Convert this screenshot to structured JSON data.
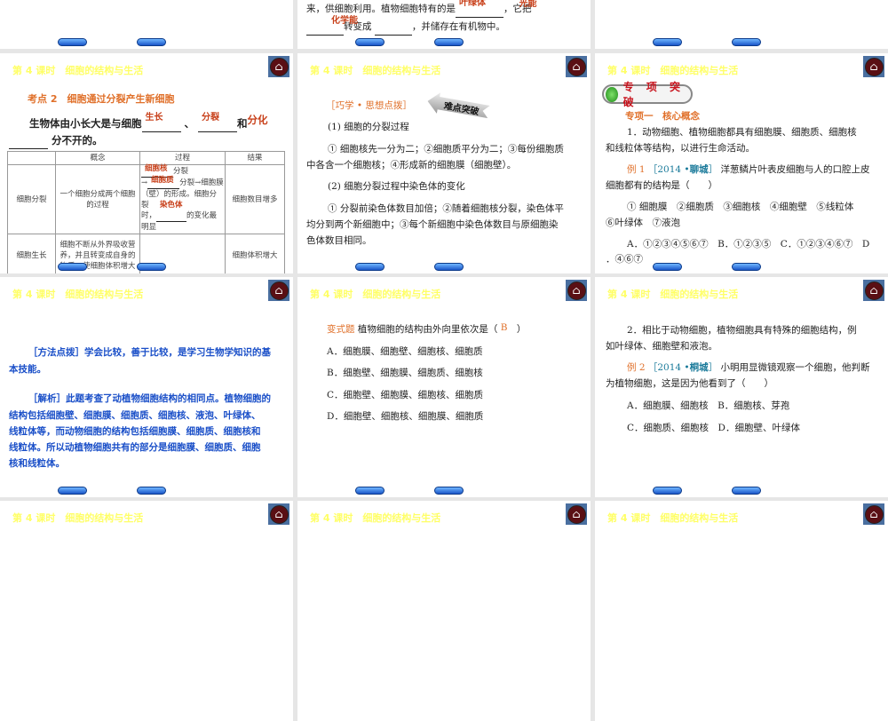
{
  "header": "第 4 课时　细胞的结构与生活",
  "top_mid": {
    "line1": "来，供细胞利用。植物细胞特有的是",
    "comma": "，它把",
    "line2b": "转变成",
    "line2c": "，并储存在有机物中。",
    "ans1": "叶绿体",
    "ans2": "光能",
    "ans3": "化学能"
  },
  "s1": {
    "heading": "考点 2　细胞通过分裂产生新细胞",
    "sent_a": "生物体由小长大是与细胞",
    "sep": "、",
    "and": "和",
    "sent_b": "分不开的。",
    "a1": "生长",
    "a2": "分裂",
    "a3": "分化",
    "table": {
      "headers": [
        "",
        "概念",
        "过程",
        "结果"
      ],
      "row1": {
        "name": "细胞分裂",
        "concept": "一个细胞分成两个细胞的过程",
        "p1": "分裂",
        "p2": "分裂→细胞膜（壁）的形成。细胞分裂",
        "p3": "时，",
        "p4": "的变化最明显",
        "pa1": "细胞核",
        "pa2": "细胞质",
        "pa3": "染色体",
        "result": "细胞数目增多"
      },
      "row2": {
        "name": "细胞生长",
        "concept": "细胞不断从外界吸收营养，并且转变成自身的物质，使细胞体积增大",
        "process": "",
        "result": "细胞体积增大"
      }
    }
  },
  "s2": {
    "tag": "［巧学 • 思想点拨］",
    "sign": "难点突破",
    "h1": "(1) 细胞的分裂过程",
    "p1a": "① 细胞核先一分为二；②细胞质平分为二；③每份细胞质",
    "p1b": "中各含一个细胞核；④形成新的细胞膜（细胞壁）。",
    "h2": "(2) 细胞分裂过程中染色体的变化",
    "p2a": "① 分裂前染色体数目加倍；②随着细胞核分裂，染色体平",
    "p2b": "均分到两个新细胞中；③每个新细胞中染色体数目与原细胞染",
    "p2c": "色体数目相同。"
  },
  "s3": {
    "badge": "专 项 突 破",
    "sub": "专项一　核心概念",
    "l1": "1．动物细胞、植物细胞都具有细胞膜、细胞质、细胞核",
    "l2": "和线粒体等结构，以进行生命活动。",
    "ex": "例 1",
    "src_a": "［2014 •",
    "src_city": "聊城",
    "src_b": "］",
    "q1": "洋葱鳞片叶表皮细胞与人的口腔上皮",
    "q2": "细胞都有的结构是（　　）",
    "o1": "① 细胞膜　②细胞质　③细胞核　④细胞壁　⑤线粒体",
    "o2": "⑥叶绿体　⑦液泡",
    "ans1": "A．①②③④⑤⑥⑦　B．①②③⑤　C．①②③④⑥⑦　D",
    "ans2": "．④⑥⑦"
  },
  "s4": {
    "l1": "［方法点拨］学会比较，善于比较，是学习生物学知识的基",
    "l2": "本技能。",
    "l3": "［解析］此题考查了动植物细胞结构的相同点。植物细胞的",
    "l4": "结构包括细胞壁、细胞膜、细胞质、细胞核、液泡、叶绿体、",
    "l5": "线粒体等，而动物细胞的结构包括细胞膜、细胞质、细胞核和",
    "l6": "线粒体。所以动植物细胞共有的部分是细胞膜、细胞质、细胞",
    "l7": "核和线粒体。"
  },
  "s5": {
    "label": "变式题",
    "q": "植物细胞的结构由外向里依次是（",
    "ans": "B",
    "close": "）",
    "opts": [
      "A．细胞膜、细胞壁、细胞核、细胞质",
      "B．细胞壁、细胞膜、细胞质、细胞核",
      "C．细胞壁、细胞膜、细胞核、细胞质",
      "D．细胞壁、细胞核、细胞膜、细胞质"
    ]
  },
  "s6": {
    "l1": "2．相比于动物细胞，植物细胞具有特殊的细胞结构，例",
    "l2": "如叶绿体、细胞壁和液泡。",
    "ex": "例 2",
    "src_a": "［2014 •",
    "src_city": "桐城",
    "src_b": "］",
    "q1": "小明用显微镜观察一个细胞，他判断",
    "q2": "为植物细胞，这是因为他看到了（　　）",
    "o1": "A．细胞膜、细胞核　B．细胞核、芽孢",
    "o2": "C．细胞质、细胞核　D．细胞壁、叶绿体"
  }
}
